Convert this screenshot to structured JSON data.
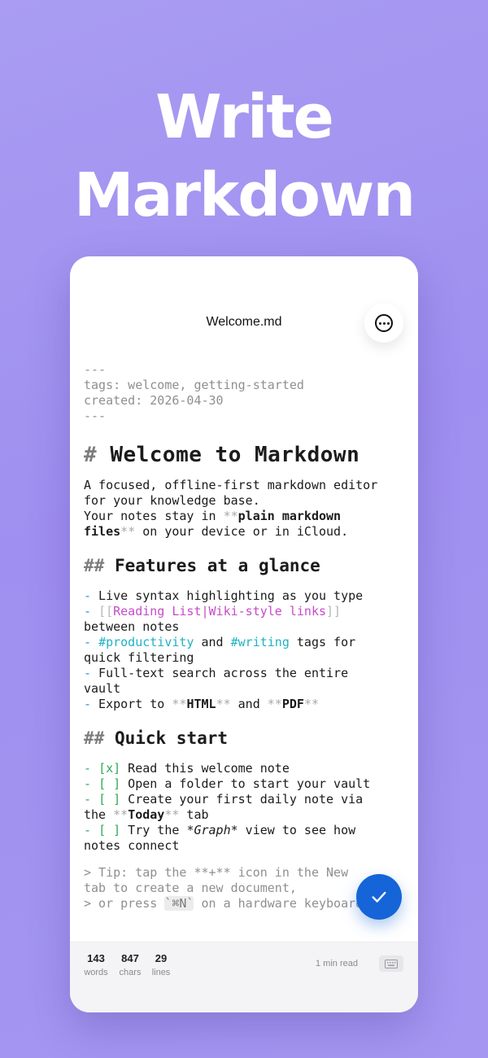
{
  "hero": {
    "line1": "Write",
    "line2": "Markdown"
  },
  "nav": {
    "title": "Welcome.md",
    "more_icon": "more-circle-icon"
  },
  "frontmatter": {
    "open": "---",
    "tags": "tags: welcome, getting-started",
    "created": "created: 2026-04-30",
    "close": "---"
  },
  "doc": {
    "h1_hash": "#",
    "h1_text": "Welcome to Markdown",
    "intro1": "A focused, offline-first markdown editor",
    "intro2": "for your knowledge base.",
    "intro3": "Your notes stay in ",
    "intro3_stars": "**",
    "intro3_bold": "plain markdown",
    "intro4_bold": "files",
    "intro4_stars": "**",
    "intro4_rest": " on your device or in iCloud.",
    "h2a_hash": "##",
    "h2a_text": "Features at a glance",
    "dash": "-",
    "f1": " Live syntax highlighting as you type",
    "f2_open": "[[",
    "f2_link": "Reading List|Wiki-style links",
    "f2_close": "]]",
    "f2_cont": "between notes",
    "f3_tag1": "#productivity",
    "f3_and": " and ",
    "f3_tag2": "#writing",
    "f3_rest": " tags for",
    "f3_cont": "quick filtering",
    "f4": " Full-text search across the entire",
    "f4_cont": "vault",
    "f5_pre": " Export to ",
    "f5_stars": "**",
    "f5_b1": "HTML",
    "f5_and": " and ",
    "f5_b2": "PDF",
    "h2b_hash": "##",
    "h2b_text": "Quick start",
    "chk_done": "[x]",
    "chk_open": "[ ]",
    "q1": " Read this welcome note",
    "q2": " Open a folder to start your vault",
    "q3": " Create your first daily note via",
    "q3_cont_pre": "the ",
    "q3_bold": "Today",
    "q3_cont_post": " tab",
    "q4_pre": " Try the ",
    "q4_em": "*Graph*",
    "q4_post": " view to see how",
    "q4_cont": "notes connect",
    "tip1": "> Tip: tap the **+** icon in the New",
    "tip2": "tab to create a new document,",
    "tip3_pre": "> or press ",
    "tip3_kbd": "`⌘N`",
    "tip3_post": " on a hardware keyboard."
  },
  "stats": {
    "words_n": "143",
    "words_l": "words",
    "chars_n": "847",
    "chars_l": "chars",
    "lines_n": "29",
    "lines_l": "lines",
    "read_time": "1 min read"
  },
  "colors": {
    "accent": "#1565d8",
    "background": "#a99cf2"
  }
}
